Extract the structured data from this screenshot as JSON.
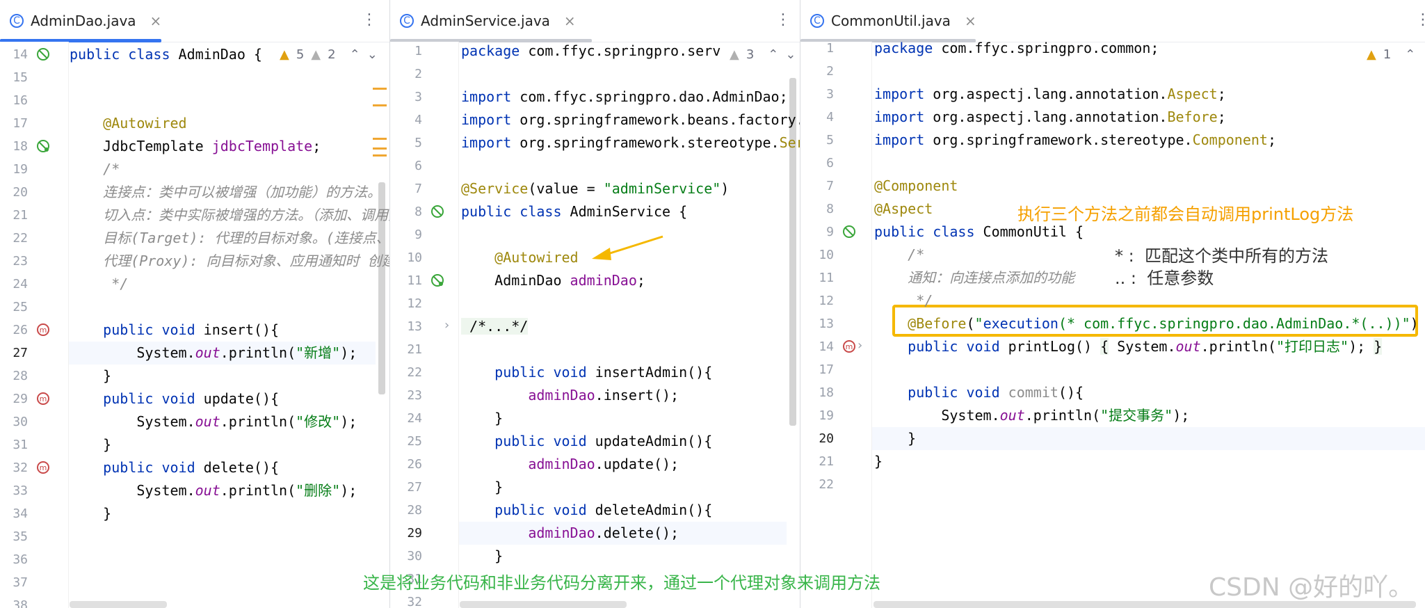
{
  "colors": {
    "accent": "#3574f0",
    "highlight": "#f5b800",
    "note_orange": "#f5a000",
    "note_green": "#39b54a"
  },
  "panes": [
    {
      "tab": {
        "icon": "C",
        "label": "AdminDao.java"
      },
      "warnings": {
        "warn": "5",
        "weak": "2"
      },
      "current_line": "27",
      "lines": [
        {
          "n": "14",
          "code": [
            [
              "kw",
              "public class "
            ],
            [
              "",
              "AdminDao {"
            ]
          ]
        },
        {
          "n": "15",
          "code": []
        },
        {
          "n": "16",
          "code": []
        },
        {
          "n": "17",
          "code": [
            [
              "",
              "    "
            ],
            [
              "ann",
              "@Autowired"
            ]
          ]
        },
        {
          "n": "18",
          "code": [
            [
              "",
              "    JdbcTemplate "
            ],
            [
              "fld",
              "jdbcTemplate"
            ],
            [
              "",
              ";"
            ]
          ]
        },
        {
          "n": "19",
          "code": [
            [
              "cmt",
              "    /*"
            ]
          ]
        },
        {
          "n": "20",
          "code": [
            [
              "cmt",
              "    连接点：类中可以被增强（加功能）的方法。"
            ]
          ]
        },
        {
          "n": "21",
          "code": [
            [
              "cmt",
              "    切入点：类中实际被增强的方法。（添加、调用方"
            ]
          ]
        },
        {
          "n": "22",
          "code": [
            [
              "cmt",
              "    目标(Target): 代理的目标对象。(连接点、切"
            ]
          ]
        },
        {
          "n": "23",
          "code": [
            [
              "cmt",
              "    代理(Proxy): 向目标对象、应用通知时 创建的"
            ]
          ]
        },
        {
          "n": "24",
          "code": [
            [
              "cmt",
              "     */"
            ]
          ]
        },
        {
          "n": "25",
          "code": []
        },
        {
          "n": "26",
          "code": [
            [
              "kw",
              "    public void "
            ],
            [
              "",
              "insert(){"
            ]
          ]
        },
        {
          "n": "27",
          "code": [
            [
              "",
              "        System."
            ],
            [
              "stat",
              "out"
            ],
            [
              "",
              ".println("
            ],
            [
              "str",
              "\"新增\""
            ],
            [
              "",
              ");"
            ]
          ]
        },
        {
          "n": "28",
          "code": [
            [
              "",
              "    }"
            ]
          ]
        },
        {
          "n": "29",
          "code": [
            [
              "kw",
              "    public void "
            ],
            [
              "",
              "update(){"
            ]
          ]
        },
        {
          "n": "30",
          "code": [
            [
              "",
              "        System."
            ],
            [
              "stat",
              "out"
            ],
            [
              "",
              ".println("
            ],
            [
              "str",
              "\"修改\""
            ],
            [
              "",
              ");"
            ]
          ]
        },
        {
          "n": "31",
          "code": [
            [
              "",
              "    }"
            ]
          ]
        },
        {
          "n": "32",
          "code": [
            [
              "kw",
              "    public void "
            ],
            [
              "",
              "delete(){"
            ]
          ]
        },
        {
          "n": "33",
          "code": [
            [
              "",
              "        System."
            ],
            [
              "stat",
              "out"
            ],
            [
              "",
              ".println("
            ],
            [
              "str",
              "\"删除\""
            ],
            [
              "",
              ");"
            ]
          ]
        },
        {
          "n": "34",
          "code": [
            [
              "",
              "    }"
            ]
          ]
        },
        {
          "n": "35",
          "code": []
        },
        {
          "n": "36",
          "code": []
        },
        {
          "n": "37",
          "code": []
        },
        {
          "n": "38",
          "code": []
        }
      ]
    },
    {
      "tab": {
        "icon": "C",
        "label": "AdminService.java"
      },
      "warnings": {
        "warn": "3"
      },
      "current_line": "29",
      "lines": [
        {
          "n": "1",
          "code": [
            [
              "kw",
              "package "
            ],
            [
              "",
              "com.ffyc.springpro.serv"
            ]
          ]
        },
        {
          "n": "2",
          "code": []
        },
        {
          "n": "3",
          "code": [
            [
              "kw",
              "import "
            ],
            [
              "",
              "com.ffyc.springpro.dao.AdminDao;"
            ]
          ]
        },
        {
          "n": "4",
          "code": [
            [
              "kw",
              "import "
            ],
            [
              "",
              "org.springframework.beans.factory."
            ]
          ]
        },
        {
          "n": "5",
          "code": [
            [
              "kw",
              "import "
            ],
            [
              "",
              "org.springframework.stereotype."
            ],
            [
              "ann",
              "Ser"
            ]
          ]
        },
        {
          "n": "6",
          "code": []
        },
        {
          "n": "7",
          "code": [
            [
              "ann",
              "@Service"
            ],
            [
              "",
              "(value = "
            ],
            [
              "str",
              "\"adminService\""
            ],
            [
              "",
              ")"
            ]
          ]
        },
        {
          "n": "8",
          "code": [
            [
              "kw",
              "public class "
            ],
            [
              "",
              "AdminService {"
            ]
          ]
        },
        {
          "n": "9",
          "code": []
        },
        {
          "n": "10",
          "code": [
            [
              "",
              "    "
            ],
            [
              "ann",
              "@Autowired"
            ]
          ]
        },
        {
          "n": "11",
          "code": [
            [
              "",
              "    AdminDao "
            ],
            [
              "fld",
              "adminDao"
            ],
            [
              "",
              ";"
            ]
          ]
        },
        {
          "n": "12",
          "code": []
        },
        {
          "n": "13",
          "code": [
            [
              "fold",
              " /*...*/"
            ]
          ]
        },
        {
          "n": "21",
          "code": []
        },
        {
          "n": "22",
          "code": [
            [
              "kw",
              "    public void "
            ],
            [
              "",
              "insertAdmin(){"
            ]
          ]
        },
        {
          "n": "23",
          "code": [
            [
              "",
              "        "
            ],
            [
              "fld",
              "adminDao"
            ],
            [
              "",
              ".insert();"
            ]
          ]
        },
        {
          "n": "24",
          "code": [
            [
              "",
              "    }"
            ]
          ]
        },
        {
          "n": "25",
          "code": [
            [
              "kw",
              "    public void "
            ],
            [
              "",
              "updateAdmin(){"
            ]
          ]
        },
        {
          "n": "26",
          "code": [
            [
              "",
              "        "
            ],
            [
              "fld",
              "adminDao"
            ],
            [
              "",
              ".update();"
            ]
          ]
        },
        {
          "n": "27",
          "code": [
            [
              "",
              "    }"
            ]
          ]
        },
        {
          "n": "28",
          "code": [
            [
              "kw",
              "    public void "
            ],
            [
              "",
              "deleteAdmin(){"
            ]
          ]
        },
        {
          "n": "29",
          "code": [
            [
              "",
              "        "
            ],
            [
              "fld",
              "adminDao"
            ],
            [
              "",
              ".delete();"
            ]
          ]
        },
        {
          "n": "30",
          "code": [
            [
              "",
              "    }"
            ]
          ]
        },
        {
          "n": "31",
          "code": []
        },
        {
          "n": "32",
          "code": []
        }
      ]
    },
    {
      "tab": {
        "icon": "C",
        "label": "CommonUtil.java"
      },
      "warnings": {
        "warn": "1"
      },
      "current_line": "20",
      "lines": [
        {
          "n": "1",
          "code": [
            [
              "kw",
              "package "
            ],
            [
              "",
              "com.ffyc.springpro.common;"
            ]
          ]
        },
        {
          "n": "2",
          "code": []
        },
        {
          "n": "3",
          "code": [
            [
              "kw",
              "import "
            ],
            [
              "",
              "org.aspectj.lang.annotation."
            ],
            [
              "ann",
              "Aspect"
            ],
            [
              "",
              ";"
            ]
          ]
        },
        {
          "n": "4",
          "code": [
            [
              "kw",
              "import "
            ],
            [
              "",
              "org.aspectj.lang.annotation."
            ],
            [
              "ann",
              "Before"
            ],
            [
              "",
              ";"
            ]
          ]
        },
        {
          "n": "5",
          "code": [
            [
              "kw",
              "import "
            ],
            [
              "",
              "org.springframework.stereotype."
            ],
            [
              "ann",
              "Component"
            ],
            [
              "",
              ";"
            ]
          ]
        },
        {
          "n": "6",
          "code": []
        },
        {
          "n": "7",
          "code": [
            [
              "ann",
              "@Component"
            ]
          ]
        },
        {
          "n": "8",
          "code": [
            [
              "ann",
              "@Aspect"
            ]
          ]
        },
        {
          "n": "9",
          "code": [
            [
              "kw",
              "public class "
            ],
            [
              "",
              "CommonUtil {"
            ]
          ]
        },
        {
          "n": "10",
          "code": [
            [
              "cmt",
              "    /*"
            ]
          ]
        },
        {
          "n": "11",
          "code": [
            [
              "cmt",
              "    通知：向连接点添加的功能"
            ]
          ]
        },
        {
          "n": "12",
          "code": [
            [
              "cmt",
              "     */"
            ]
          ]
        },
        {
          "n": "13",
          "code": [
            [
              "",
              "    "
            ],
            [
              "ann",
              "@Before"
            ],
            [
              "",
              "("
            ],
            [
              "str",
              "\""
            ],
            [
              "kw",
              "execution"
            ],
            [
              "str",
              "(* com.ffyc.springpro.dao.AdminDao.*(..))\""
            ],
            [
              "",
              ")"
            ]
          ]
        },
        {
          "n": "14",
          "code": [
            [
              "kw",
              "    public void "
            ],
            [
              "",
              "printLog() "
            ],
            [
              "fold",
              "{"
            ],
            [
              "",
              " System."
            ],
            [
              "stat",
              "out"
            ],
            [
              "",
              ".println("
            ],
            [
              "str",
              "\"打印日志\""
            ],
            [
              "",
              "); "
            ],
            [
              "fold",
              "}"
            ]
          ]
        },
        {
          "n": "17",
          "code": []
        },
        {
          "n": "18",
          "code": [
            [
              "kw",
              "    public void "
            ],
            [
              "cmt2",
              "commit"
            ],
            [
              "",
              "(){"
            ]
          ]
        },
        {
          "n": "19",
          "code": [
            [
              "",
              "        System."
            ],
            [
              "stat",
              "out"
            ],
            [
              "",
              ".println("
            ],
            [
              "str",
              "\"提交事务\""
            ],
            [
              "",
              ");"
            ]
          ]
        },
        {
          "n": "20",
          "code": [
            [
              "",
              "    }"
            ]
          ]
        },
        {
          "n": "21",
          "code": [
            [
              "",
              "}"
            ]
          ]
        },
        {
          "n": "22",
          "code": []
        }
      ]
    }
  ],
  "notes": {
    "orange": "执行三个方法之前都会自动调用printLog方法",
    "star": "* :  匹配这个类中所有的方法",
    "dots": ".. :  任意参数",
    "green": "这是将业务代码和非业务代码分离开来，通过一个代理对象来调用方法"
  },
  "watermark": "CSDN @好的吖。"
}
